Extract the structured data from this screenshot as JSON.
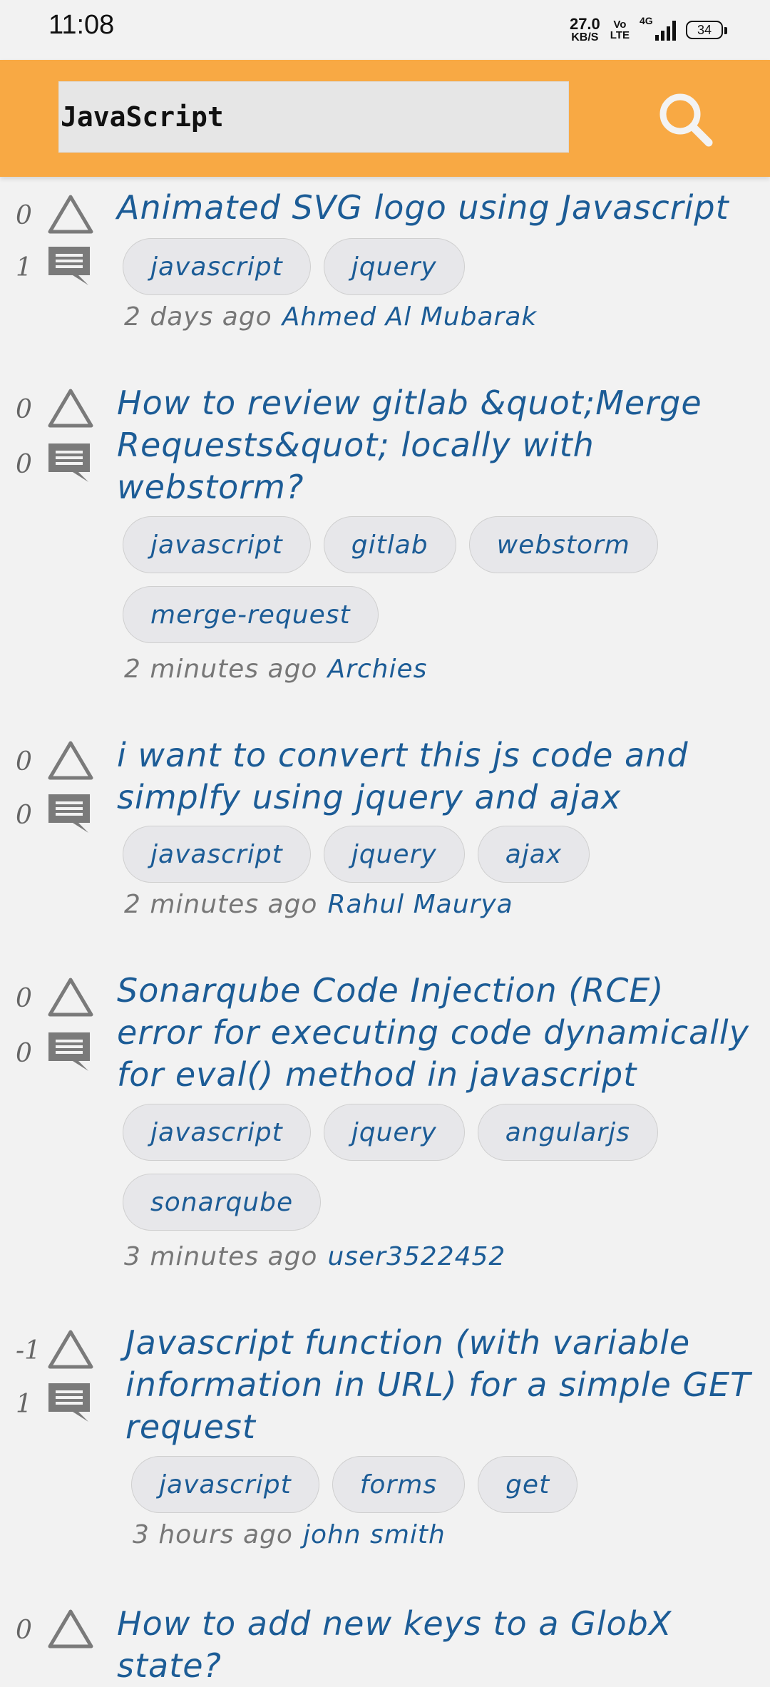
{
  "status_bar": {
    "time": "11:08",
    "net_speed_value": "27.0",
    "net_speed_unit": "KB/S",
    "volte_top": "Vo",
    "volte_bottom": "LTE",
    "network": "4G",
    "battery": "34"
  },
  "toolbar": {
    "search_value": "JavaScript",
    "accent_color": "#f8a944"
  },
  "questions": [
    {
      "votes": "0",
      "answers": "1",
      "title": "Animated SVG logo using Javascript",
      "tags": [
        "javascript",
        "jquery"
      ],
      "time": "2 days ago",
      "user": "Ahmed Al Mubarak"
    },
    {
      "votes": "0",
      "answers": "0",
      "title": "How to review gitlab &quot;Merge Requests&quot; locally with webstorm?",
      "tags": [
        "javascript",
        "gitlab",
        "webstorm",
        "merge-request"
      ],
      "time": "2 minutes ago",
      "user": "Archies"
    },
    {
      "votes": "0",
      "answers": "0",
      "title": "i want to convert this js code and simplfy using jquery and ajax",
      "tags": [
        "javascript",
        "jquery",
        "ajax"
      ],
      "time": "2 minutes ago",
      "user": "Rahul Maurya"
    },
    {
      "votes": "0",
      "answers": "0",
      "title": "Sonarqube Code Injection (RCE) error for executing code dynamically for eval() method in javascript",
      "tags": [
        "javascript",
        "jquery",
        "angularjs",
        "sonarqube"
      ],
      "time": "3 minutes ago",
      "user": "user3522452"
    },
    {
      "votes": "-1",
      "answers": "1",
      "title": "Javascript function (with variable information in URL) for a simple GET request",
      "tags": [
        "javascript",
        "forms",
        "get"
      ],
      "time": "3 hours ago",
      "user": "john smith"
    },
    {
      "votes": "0",
      "answers": "",
      "title": "How to add new keys to a GlobX state?",
      "tags": [],
      "time": "",
      "user": ""
    }
  ]
}
